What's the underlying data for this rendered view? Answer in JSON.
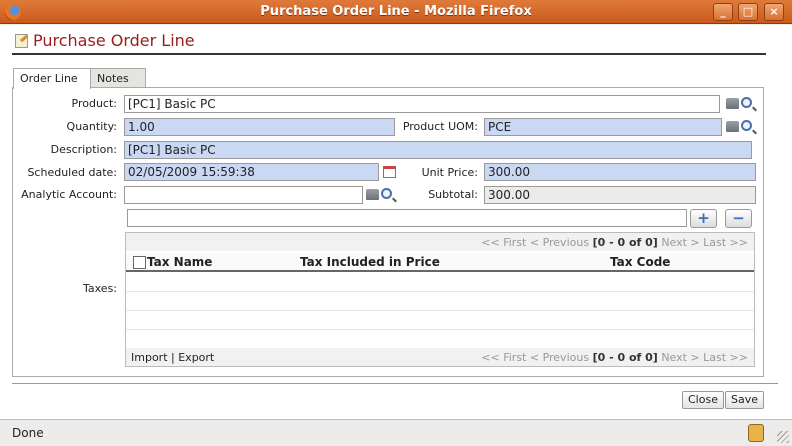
{
  "window": {
    "title": "Purchase Order Line - Mozilla Firefox",
    "buttons": [
      "_",
      "□",
      "×"
    ]
  },
  "page": {
    "title": "Purchase Order Line"
  },
  "tabs": [
    {
      "label": "Order Line"
    },
    {
      "label": "Notes"
    }
  ],
  "form": {
    "product": {
      "label": "Product:",
      "value": "[PC1] Basic PC"
    },
    "quantity": {
      "label": "Quantity:",
      "value": "1.00"
    },
    "uom": {
      "label": "Product UOM:",
      "value": "PCE"
    },
    "description": {
      "label": "Description:",
      "value": "[PC1] Basic PC"
    },
    "scheduled": {
      "label": "Scheduled date:",
      "value": "02/05/2009 15:59:38"
    },
    "unit_price": {
      "label": "Unit Price:",
      "value": "300.00"
    },
    "analytic": {
      "label": "Analytic Account:",
      "value": ""
    },
    "subtotal": {
      "label": "Subtotal:",
      "value": "300.00"
    },
    "taxes": {
      "label": "Taxes:"
    }
  },
  "taxes_grid": {
    "add_symbol": "+",
    "remove_symbol": "−",
    "pager": {
      "prev": "<< First < Previous",
      "range": "[0 - 0 of 0]",
      "next": "Next > Last >>"
    },
    "columns": [
      "Tax Name",
      "Tax Included in Price",
      "Tax Code"
    ],
    "import_label": "Import",
    "sep": "|",
    "export_label": "Export"
  },
  "buttons": {
    "close": "Close",
    "save": "Save"
  },
  "status": {
    "text": "Done"
  }
}
